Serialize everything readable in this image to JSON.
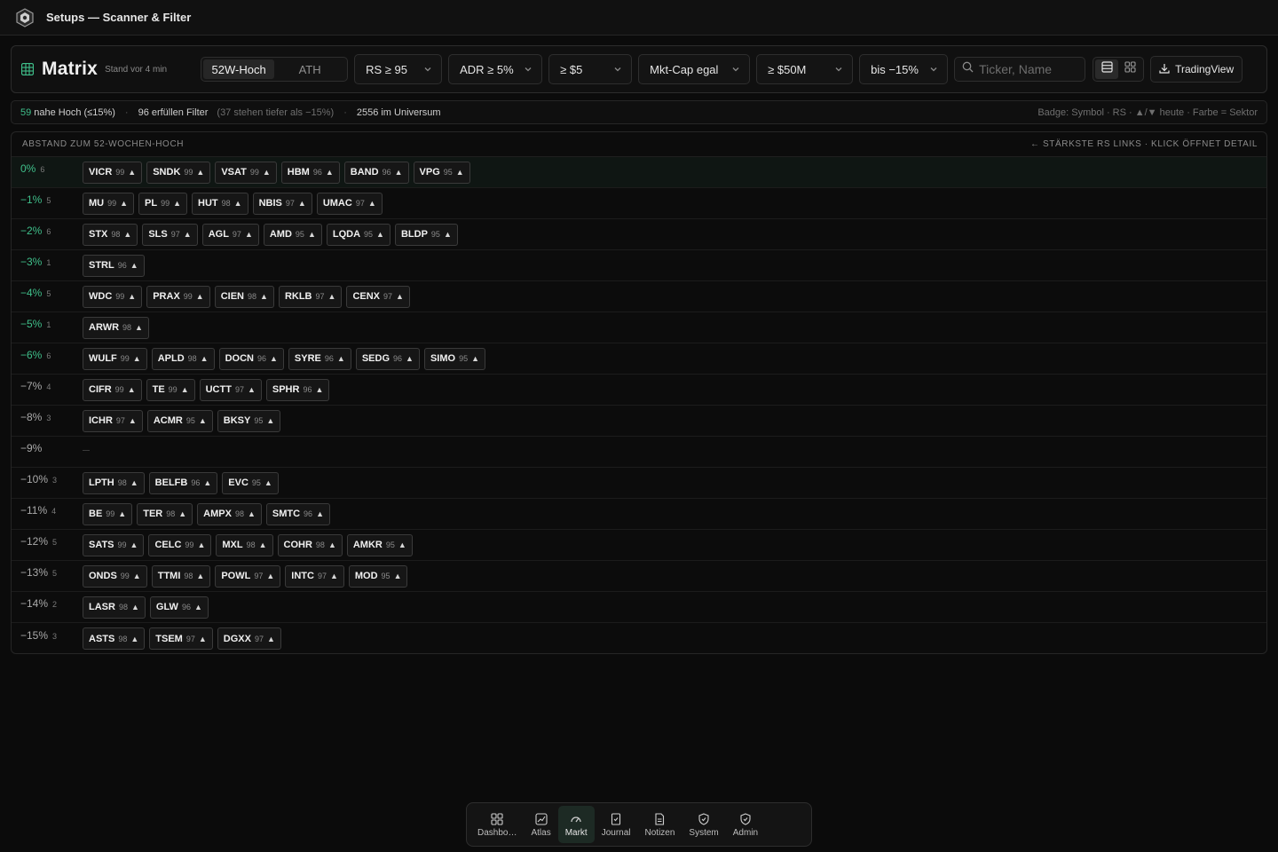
{
  "app": {
    "title": "Setups — Scanner & Filter"
  },
  "header": {
    "title": "Matrix",
    "subtitle": "Stand vor 4 min",
    "mode_options": [
      "52W-Hoch",
      "ATH"
    ],
    "mode_selected": "52W-Hoch",
    "filters": {
      "rs": "RS ≥ 95",
      "adr": "ADR ≥ 5%",
      "price": "≥ $5",
      "mktcap": "Mkt-Cap egal",
      "volume": "≥ $50M",
      "distance": "bis −15%"
    },
    "search_placeholder": "Ticker, Name",
    "search_value": "",
    "export_label": "TradingView"
  },
  "stats": {
    "near_high_count": "59",
    "near_high_label": "nahe Hoch (≤15%)",
    "filter_count": "96",
    "filter_label": "erfüllen Filter",
    "deeper_note": "(37 stehen tiefer als −15%)",
    "universe_count": "2556",
    "universe_label": "im Universum",
    "legend": "Badge: Symbol · RS · ▲/▼ heute · Farbe = Sektor"
  },
  "matrix": {
    "header_left": "ABSTAND ZUM 52-WOCHEN-HOCH",
    "header_right": "← STÄRKSTE RS LINKS · KLICK ÖFFNET DETAIL",
    "rows": [
      {
        "label": "0%",
        "count": "6",
        "tickers": [
          [
            "VICR",
            "99",
            "▲"
          ],
          [
            "SNDK",
            "99",
            "▲"
          ],
          [
            "VSAT",
            "99",
            "▲"
          ],
          [
            "HBM",
            "96",
            "▲"
          ],
          [
            "BAND",
            "96",
            "▲"
          ],
          [
            "VPG",
            "95",
            "▲"
          ]
        ]
      },
      {
        "label": "−1%",
        "count": "5",
        "tickers": [
          [
            "MU",
            "99",
            "▲"
          ],
          [
            "PL",
            "99",
            "▲"
          ],
          [
            "HUT",
            "98",
            "▲"
          ],
          [
            "NBIS",
            "97",
            "▲"
          ],
          [
            "UMAC",
            "97",
            "▲"
          ]
        ]
      },
      {
        "label": "−2%",
        "count": "6",
        "tickers": [
          [
            "STX",
            "98",
            "▲"
          ],
          [
            "SLS",
            "97",
            "▲"
          ],
          [
            "AGL",
            "97",
            "▲"
          ],
          [
            "AMD",
            "95",
            "▲"
          ],
          [
            "LQDA",
            "95",
            "▲"
          ],
          [
            "BLDP",
            "95",
            "▲"
          ]
        ]
      },
      {
        "label": "−3%",
        "count": "1",
        "tickers": [
          [
            "STRL",
            "96",
            "▲"
          ]
        ]
      },
      {
        "label": "−4%",
        "count": "5",
        "tickers": [
          [
            "WDC",
            "99",
            "▲"
          ],
          [
            "PRAX",
            "99",
            "▲"
          ],
          [
            "CIEN",
            "98",
            "▲"
          ],
          [
            "RKLB",
            "97",
            "▲"
          ],
          [
            "CENX",
            "97",
            "▲"
          ]
        ]
      },
      {
        "label": "−5%",
        "count": "1",
        "tickers": [
          [
            "ARWR",
            "98",
            "▲"
          ]
        ]
      },
      {
        "label": "−6%",
        "count": "6",
        "tickers": [
          [
            "WULF",
            "99",
            "▲"
          ],
          [
            "APLD",
            "98",
            "▲"
          ],
          [
            "DOCN",
            "96",
            "▲"
          ],
          [
            "SYRE",
            "96",
            "▲"
          ],
          [
            "SEDG",
            "96",
            "▲"
          ],
          [
            "SIMO",
            "95",
            "▲"
          ]
        ]
      },
      {
        "label": "−7%",
        "count": "4",
        "tickers": [
          [
            "CIFR",
            "99",
            "▲"
          ],
          [
            "TE",
            "99",
            "▲"
          ],
          [
            "UCTT",
            "97",
            "▲"
          ],
          [
            "SPHR",
            "96",
            "▲"
          ]
        ]
      },
      {
        "label": "−8%",
        "count": "3",
        "tickers": [
          [
            "ICHR",
            "97",
            "▲"
          ],
          [
            "ACMR",
            "95",
            "▲"
          ],
          [
            "BKSY",
            "95",
            "▲"
          ]
        ]
      },
      {
        "label": "−9%",
        "count": "",
        "tickers": []
      },
      {
        "label": "−10%",
        "count": "3",
        "tickers": [
          [
            "LPTH",
            "98",
            "▲"
          ],
          [
            "BELFB",
            "96",
            "▲"
          ],
          [
            "EVC",
            "95",
            "▲"
          ]
        ]
      },
      {
        "label": "−11%",
        "count": "4",
        "tickers": [
          [
            "BE",
            "99",
            "▲"
          ],
          [
            "TER",
            "98",
            "▲"
          ],
          [
            "AMPX",
            "98",
            "▲"
          ],
          [
            "SMTC",
            "96",
            "▲"
          ]
        ]
      },
      {
        "label": "−12%",
        "count": "5",
        "tickers": [
          [
            "SATS",
            "99",
            "▲"
          ],
          [
            "CELC",
            "99",
            "▲"
          ],
          [
            "MXL",
            "98",
            "▲"
          ],
          [
            "COHR",
            "98",
            "▲"
          ],
          [
            "AMKR",
            "95",
            "▲"
          ]
        ]
      },
      {
        "label": "−13%",
        "count": "5",
        "tickers": [
          [
            "ONDS",
            "99",
            "▲"
          ],
          [
            "TTMI",
            "98",
            "▲"
          ],
          [
            "POWL",
            "97",
            "▲"
          ],
          [
            "INTC",
            "97",
            "▲"
          ],
          [
            "MOD",
            "95",
            "▲"
          ]
        ]
      },
      {
        "label": "−14%",
        "count": "2",
        "tickers": [
          [
            "LASR",
            "98",
            "▲"
          ],
          [
            "GLW",
            "96",
            "▲"
          ]
        ]
      },
      {
        "label": "−15%",
        "count": "3",
        "tickers": [
          [
            "ASTS",
            "98",
            "▲"
          ],
          [
            "TSEM",
            "97",
            "▲"
          ],
          [
            "DGXX",
            "97",
            "▲"
          ]
        ]
      }
    ]
  },
  "nav": {
    "items": [
      {
        "label": "Dashbo…",
        "icon": "grid-icon"
      },
      {
        "label": "Atlas",
        "icon": "chart-icon"
      },
      {
        "label": "Markt",
        "icon": "gauge-icon"
      },
      {
        "label": "Journal",
        "icon": "journal-icon"
      },
      {
        "label": "Notizen",
        "icon": "note-icon"
      },
      {
        "label": "System",
        "icon": "shield-icon"
      },
      {
        "label": "Admin",
        "icon": "shield-check-icon"
      }
    ],
    "active": "Markt"
  },
  "colors": {
    "accent_green": "#3fbf8a",
    "background": "#0b0b0b",
    "chip_border": "#3a3a3a"
  }
}
